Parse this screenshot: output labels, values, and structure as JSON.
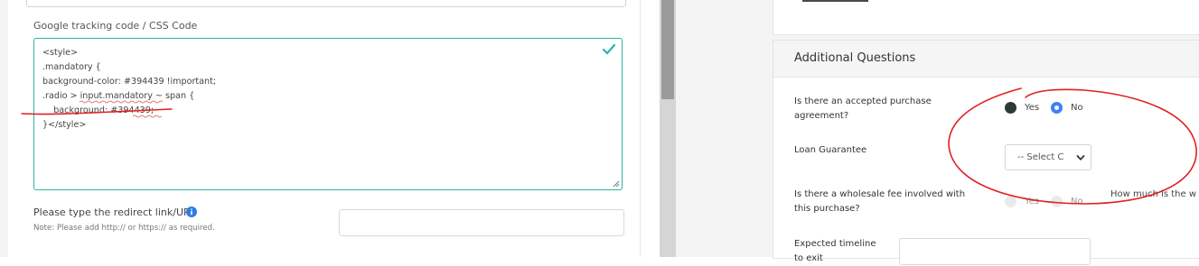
{
  "left_form": {
    "css_label": "Google tracking code / CSS Code",
    "css_lines": [
      "<style>",
      ".mandatory {",
      "background-color: #394439 !important;",
      ".radio > input.mandatory ~ span {",
      "    background: #394439;",
      "",
      "}</style>"
    ],
    "redirect_label": "Please type the redirect link/URL",
    "redirect_note": "Note: Please add http:// or https:// as required.",
    "redirect_value": ""
  },
  "additional_questions": {
    "title": "Additional Questions",
    "q1": {
      "label_line1": "Is there an accepted purchase",
      "label_line2": "agreement?",
      "yes": "Yes",
      "no": "No",
      "selected": "No"
    },
    "q2": {
      "label": "Loan Guarantee",
      "select_value": "-- Select C"
    },
    "q3": {
      "label_line1": "Is there a wholesale fee involved with",
      "label_line2": "this purchase?",
      "yes": "Yes",
      "no": "No",
      "followup": "How much is the w"
    },
    "q4": {
      "label_line1": "Expected timeline",
      "label_line2": "to exit",
      "value": ""
    }
  },
  "colors": {
    "focus_border": "#2bb5a5",
    "annotation_red": "#e02020",
    "radio_blue": "#3b82f6",
    "radio_dark": "#2d3b36"
  }
}
